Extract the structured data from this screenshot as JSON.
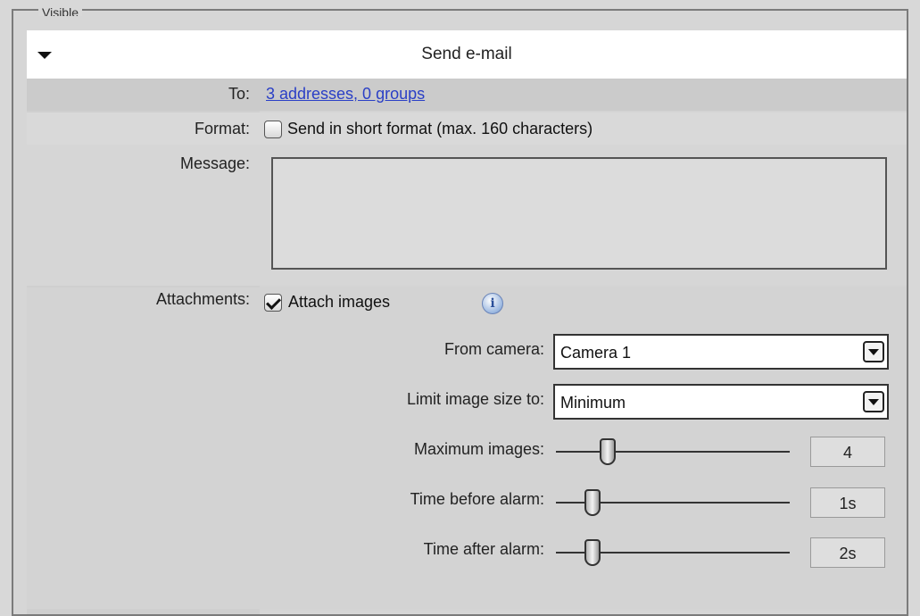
{
  "group": {
    "legend": "Visible"
  },
  "section": {
    "title": "Send e-mail",
    "collapse_icon": "triangle-down"
  },
  "to": {
    "label": "To:",
    "link": "3 addresses, 0 groups"
  },
  "format": {
    "label": "Format:",
    "checkbox_label": "Send in short format (max. 160 characters)",
    "checked": false
  },
  "message": {
    "label": "Message:",
    "value": ""
  },
  "attachments": {
    "label": "Attachments:",
    "checkbox_label": "Attach images",
    "checked": true,
    "info_icon": "info-icon",
    "from_camera": {
      "label": "From camera:",
      "value": "Camera 1"
    },
    "limit_size": {
      "label": "Limit image size to:",
      "value": "Minimum"
    },
    "max_images": {
      "label": "Maximum images:",
      "value": "4",
      "slider_fraction": 0.2
    },
    "time_before": {
      "label": "Time before alarm:",
      "value": "1s",
      "slider_fraction": 0.13
    },
    "time_after": {
      "label": "Time after alarm:",
      "value": "2s",
      "slider_fraction": 0.13
    }
  }
}
